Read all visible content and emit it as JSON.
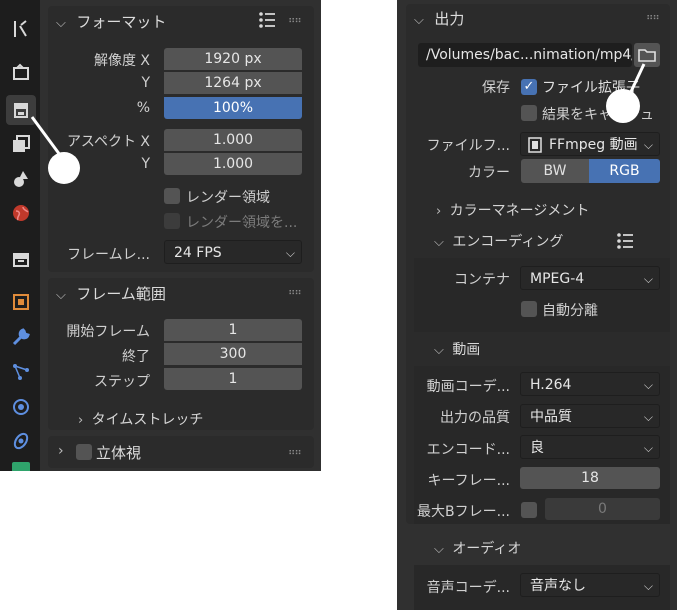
{
  "left": {
    "tabs": [
      "tool-icon",
      "render-icon",
      "output-icon",
      "view-layer-icon",
      "scene-icon",
      "world-icon",
      "collection-icon",
      "object-icon",
      "modifier-icon",
      "particles-icon",
      "physics-icon",
      "constraints-icon"
    ],
    "format": {
      "title": "フォーマット",
      "res_x_label": "解像度 X",
      "res_x": "1920 px",
      "res_y_label": "Y",
      "res_y": "1264 px",
      "percent_label": "%",
      "percent": "100%",
      "aspect_x_label": "アスペクト X",
      "aspect_x": "1.000",
      "aspect_y_label": "Y",
      "aspect_y": "1.000",
      "render_region": "レンダー領域",
      "crop_region": "レンダー領域を...",
      "framerate_label": "フレームレ...",
      "framerate": "24 FPS"
    },
    "frame_range": {
      "title": "フレーム範囲",
      "start_label": "開始フレーム",
      "start": "1",
      "end_label": "終了",
      "end": "300",
      "step_label": "ステップ",
      "step": "1",
      "time_stretch": "タイムストレッチ"
    },
    "stereo": {
      "title": "立体視"
    }
  },
  "right": {
    "output_title": "出力",
    "path": "/Volumes/bac...nimation/mp4/",
    "save_label": "保存",
    "file_ext": "ファイル拡張子",
    "cache_result": "結果をキャッシュ",
    "file_format_label": "ファイルフ...",
    "file_format": "FFmpeg 動画",
    "color_label": "カラー",
    "color_bw": "BW",
    "color_rgb": "RGB",
    "color_mgmt": "カラーマネージメント",
    "encoding_title": "エンコーディング",
    "container_label": "コンテナ",
    "container": "MPEG-4",
    "autosplit": "自動分離",
    "video_title": "動画",
    "codec_label": "動画コーデ...",
    "codec": "H.264",
    "quality_label": "出力の品質",
    "quality": "中品質",
    "speed_label": "エンコード...",
    "speed": "良",
    "keyframe_label": "キーフレー...",
    "keyframe": "18",
    "maxb_label": "最大Bフレー...",
    "maxb": "0",
    "audio_title": "オーディオ",
    "audio_codec_label": "音声コーデ...",
    "audio_codec": "音声なし"
  }
}
